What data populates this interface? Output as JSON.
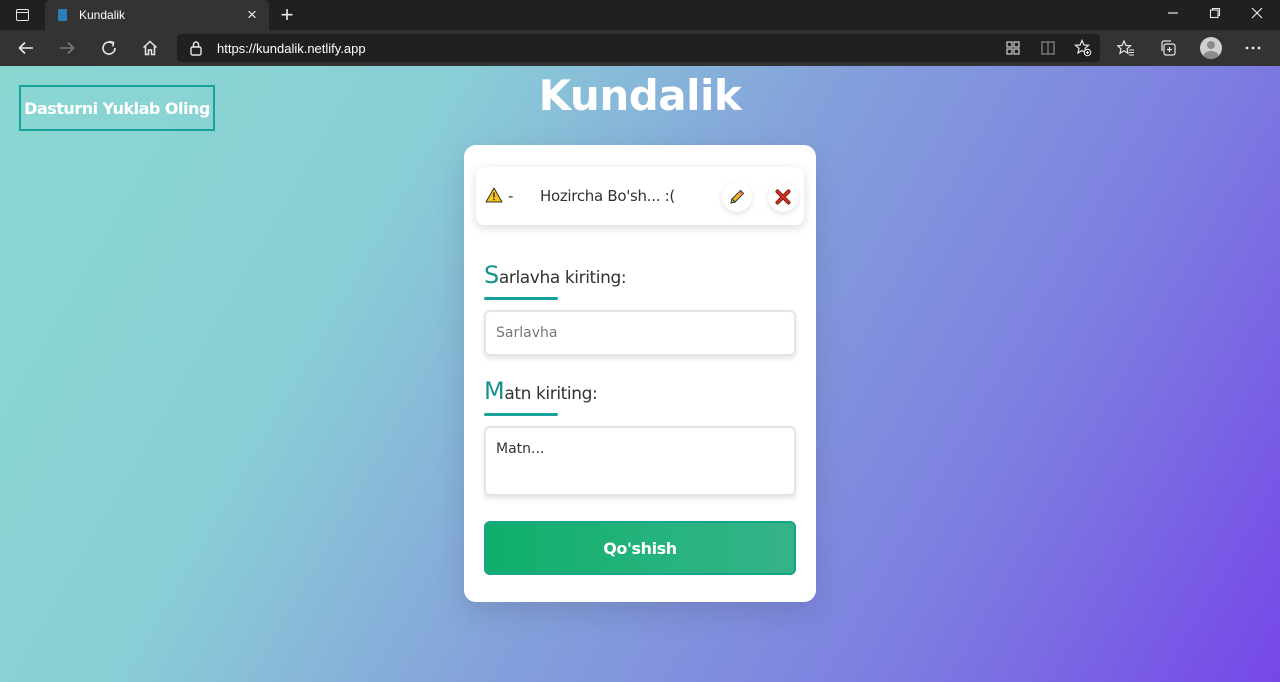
{
  "browser": {
    "tab_title": "Kundalik",
    "url": "https://kundalik.netlify.app"
  },
  "page": {
    "download_label": "Dasturni Yuklab Oling",
    "title": "Kundalik",
    "note": {
      "dash": "-",
      "text": "Hozircha Bo'sh... :("
    },
    "title_label": {
      "initial": "S",
      "rest": "arlavha kiriting:"
    },
    "title_placeholder": "Sarlavha",
    "body_label": {
      "initial": "M",
      "rest": "atn kiriting:"
    },
    "body_placeholder": "Matn...",
    "submit_label": "Qo'shish"
  },
  "colors": {
    "accent": "#17a39a",
    "button": "#0fae6a"
  }
}
